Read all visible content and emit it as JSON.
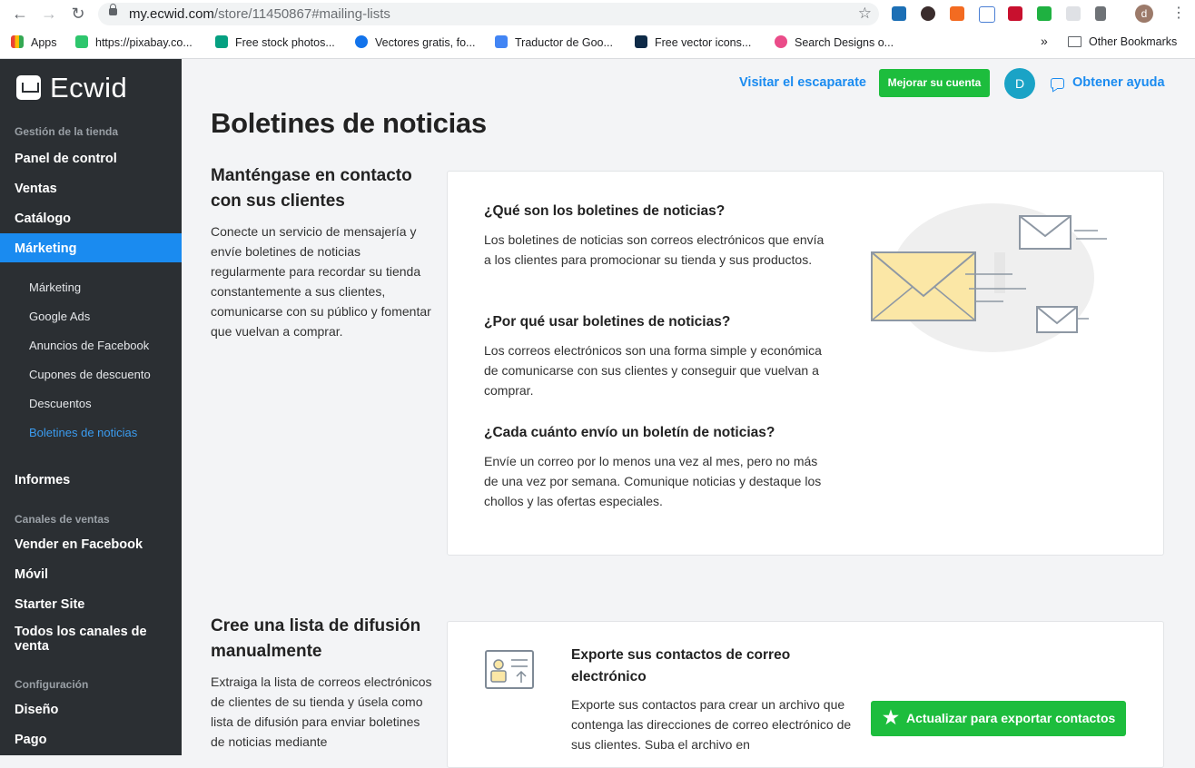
{
  "browser": {
    "url_host": "my.ecwid.com",
    "url_path": "/store/11450867#mailing-lists",
    "profile_initial": "d",
    "bookmarks": [
      {
        "label": "Apps",
        "icon": "apps-grid-icon"
      },
      {
        "label": "https://pixabay.co...",
        "icon": "pixabay-icon"
      },
      {
        "label": "Free stock photos...",
        "icon": "pexels-icon"
      },
      {
        "label": "Vectores gratis, fo...",
        "icon": "freepik-icon"
      },
      {
        "label": "Traductor de Goo...",
        "icon": "google-translate-icon"
      },
      {
        "label": "Free vector icons...",
        "icon": "flaticon-icon"
      },
      {
        "label": "Search Designs o...",
        "icon": "dribbble-icon"
      }
    ],
    "other_bookmarks": "Other Bookmarks",
    "overflow": "»"
  },
  "sidebar": {
    "logo": "Ecwid",
    "sections": {
      "store": "Gestión de la tienda",
      "channels": "Canales de ventas",
      "config": "Configuración"
    },
    "items": {
      "panel": "Panel de control",
      "ventas": "Ventas",
      "catalogo": "Catálogo",
      "marketing": "Márketing",
      "informes": "Informes",
      "facebook": "Vender en Facebook",
      "movil": "Móvil",
      "starter": "Starter Site",
      "todos": "Todos los canales de venta",
      "diseno": "Diseño",
      "pago": "Pago"
    },
    "submenu": [
      "Márketing",
      "Google Ads",
      "Anuncios de Facebook",
      "Cupones de descuento",
      "Descuentos",
      "Boletines de noticias"
    ]
  },
  "header": {
    "visit_store": "Visitar el escaparate",
    "upgrade": "Mejorar su cuenta",
    "avatar_initial": "D",
    "help": "Obtener ayuda"
  },
  "main": {
    "title": "Boletines de noticias",
    "section1": {
      "title": "Manténgase en contacto con sus clientes",
      "desc": "Conecte un servicio de mensajería y envíe boletines de noticias regularmente para recordar su tienda constantemente a sus clientes, comunicarse con su público y fomentar que vuelvan a comprar."
    },
    "faq": [
      {
        "q": "¿Qué son los boletines de noticias?",
        "a": "Los boletines de noticias son correos electrónicos que envía a los clientes para promocionar su tienda y sus productos."
      },
      {
        "q": "¿Por qué usar boletines de noticias?",
        "a": "Los correos electrónicos son una forma simple y económica de comunicarse con sus clientes y conseguir que vuelvan a comprar."
      },
      {
        "q": "¿Cada cuánto envío un boletín de noticias?",
        "a": "Envíe un correo por lo menos una vez al mes, pero no más de una vez por semana. Comunique noticias y destaque los chollos y las ofertas especiales."
      }
    ],
    "section2": {
      "title": "Cree una lista de difusión manualmente",
      "desc": "Extraiga la lista de correos electrónicos de clientes de su tienda y úsela como lista de difusión para enviar boletines de noticias mediante"
    },
    "export": {
      "title": "Exporte sus contactos de correo electrónico",
      "desc": "Exporte sus contactos para crear un archivo que contenga las direcciones de correo electrónico de sus clientes. Suba el archivo en",
      "button": "Actualizar para exportar contactos"
    }
  }
}
